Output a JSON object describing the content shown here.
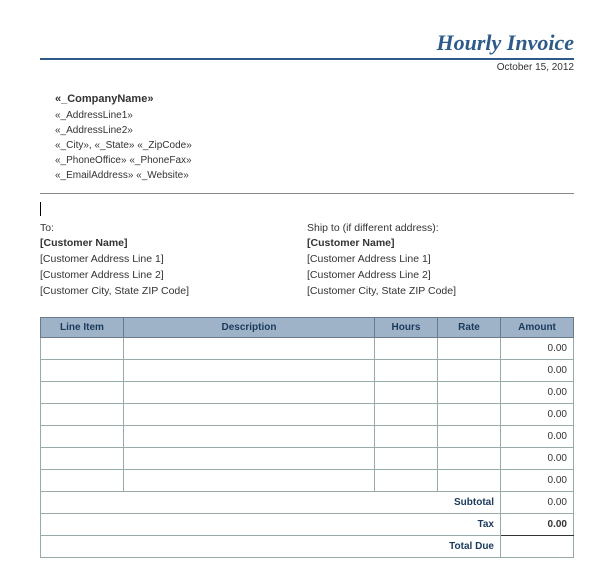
{
  "header": {
    "title": "Hourly Invoice",
    "date": "October 15, 2012"
  },
  "company": {
    "name": "«_CompanyName»",
    "addr1": "«_AddressLine1»",
    "addr2": "«_AddressLine2»",
    "city_line": "«_City», «_State»  «_ZipCode»",
    "phone_line": "«_PhoneOffice»  «_PhoneFax»",
    "web_line": "«_EmailAddress»  «_Website»"
  },
  "bill_to": {
    "label": "To:",
    "name": "[Customer Name]",
    "addr1": "[Customer Address Line 1]",
    "addr2": "[Customer Address Line 2]",
    "city": "[Customer City, State ZIP Code]"
  },
  "ship_to": {
    "label": "Ship to (if different address):",
    "name": "[Customer Name]",
    "addr1": "[Customer Address Line 1]",
    "addr2": "[Customer Address Line 2]",
    "city": "[Customer City, State ZIP Code]"
  },
  "columns": {
    "c1": "Line Item",
    "c2": "Description",
    "c3": "Hours",
    "c4": "Rate",
    "c5": "Amount"
  },
  "rows": [
    {
      "amount": "0.00"
    },
    {
      "amount": "0.00"
    },
    {
      "amount": "0.00"
    },
    {
      "amount": "0.00"
    },
    {
      "amount": "0.00"
    },
    {
      "amount": "0.00"
    },
    {
      "amount": "0.00"
    }
  ],
  "totals": {
    "subtotal_label": "Subtotal",
    "subtotal": "0.00",
    "tax_label": "Tax",
    "tax": "0.00",
    "totaldue_label": "Total Due"
  }
}
